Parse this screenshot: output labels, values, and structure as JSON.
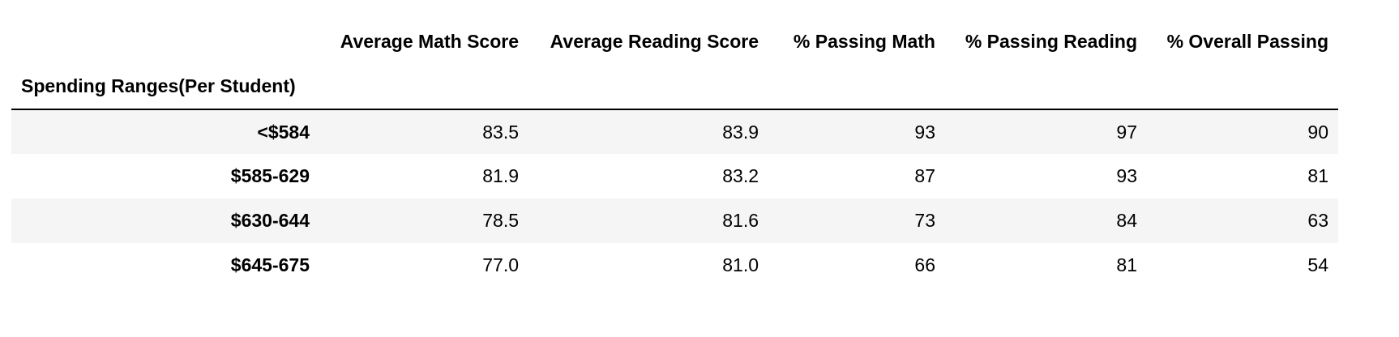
{
  "table": {
    "index_name": "Spending Ranges(Per Student)",
    "columns": [
      "Average Math Score",
      "Average Reading Score",
      "% Passing Math",
      "% Passing Reading",
      "% Overall Passing"
    ],
    "rows": [
      {
        "label": "<$584",
        "values": [
          "83.5",
          "83.9",
          "93",
          "97",
          "90"
        ]
      },
      {
        "label": "$585-629",
        "values": [
          "81.9",
          "83.2",
          "87",
          "93",
          "81"
        ]
      },
      {
        "label": "$630-644",
        "values": [
          "78.5",
          "81.6",
          "73",
          "84",
          "63"
        ]
      },
      {
        "label": "$645-675",
        "values": [
          "77.0",
          "81.0",
          "66",
          "81",
          "54"
        ]
      }
    ]
  }
}
